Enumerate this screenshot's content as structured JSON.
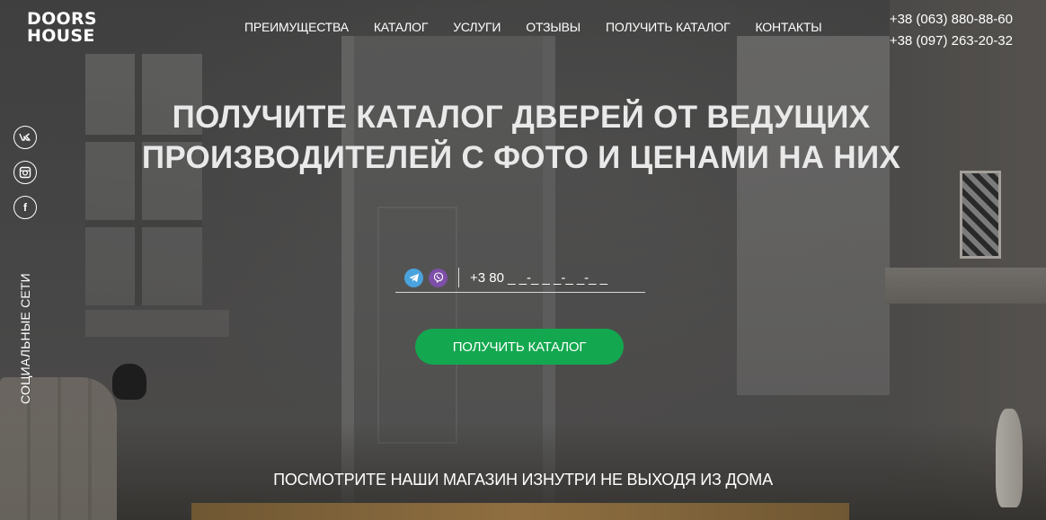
{
  "header": {
    "logo_line1": "DOORS",
    "logo_line2": "HOUSE",
    "nav": [
      {
        "label": "ПРЕИМУЩЕСТВА"
      },
      {
        "label": "КАТАЛОГ"
      },
      {
        "label": "УСЛУГИ"
      },
      {
        "label": "ОТЗЫВЫ"
      },
      {
        "label": "ПОЛУЧИТЬ КАТАЛОГ"
      },
      {
        "label": "КОНТАКТЫ"
      }
    ],
    "phones": [
      "+38 (063) 880-88-60",
      "+38 (097) 263-20-32"
    ]
  },
  "social": {
    "label": "СОЦИАЛЬНЫЕ СЕТИ",
    "items": [
      {
        "icon": "vk-icon",
        "glyph": "vk"
      },
      {
        "icon": "instagram-icon",
        "glyph": ""
      },
      {
        "icon": "facebook-icon",
        "glyph": "f"
      }
    ]
  },
  "hero": {
    "headline_line1": "ПОЛУЧИТЕ КАТАЛОГ ДВЕРЕЙ ОТ ВЕДУЩИХ",
    "headline_line2": "ПРОИЗВОДИТЕЛЕЙ С ФОТО И ЦЕНАМИ НА НИХ",
    "phone_value": "+3 80 _ _-_ _ _-_ _-_ _",
    "cta_label": "ПОЛУЧИТЬ КАТАЛОГ",
    "subheading": "ПОСМОТРИТЕ НАШИ МАГАЗИН ИЗНУТРИ НЕ ВЫХОДЯ ИЗ ДОМА"
  },
  "colors": {
    "accent": "#13a84f",
    "telegram": "#4aa3dd",
    "viber": "#7d4fa8"
  }
}
